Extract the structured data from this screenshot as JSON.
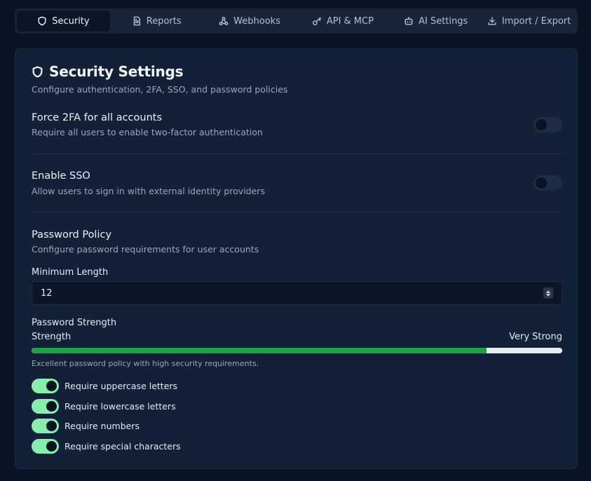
{
  "tabs": [
    {
      "label": "Security",
      "icon": "shield-icon",
      "active": true
    },
    {
      "label": "Reports",
      "icon": "document-icon",
      "active": false
    },
    {
      "label": "Webhooks",
      "icon": "webhook-icon",
      "active": false
    },
    {
      "label": "API & MCP",
      "icon": "key-icon",
      "active": false
    },
    {
      "label": "AI Settings",
      "icon": "bot-icon",
      "active": false
    },
    {
      "label": "Import / Export",
      "icon": "download-icon",
      "active": false
    }
  ],
  "card": {
    "title": "Security Settings",
    "subtitle": "Configure authentication, 2FA, SSO, and password policies"
  },
  "force2fa": {
    "title": "Force 2FA for all accounts",
    "description": "Require all users to enable two-factor authentication",
    "enabled": false
  },
  "sso": {
    "title": "Enable SSO",
    "description": "Allow users to sign in with external identity providers",
    "enabled": false
  },
  "password_policy": {
    "title": "Password Policy",
    "description": "Configure password requirements for user accounts",
    "min_length_label": "Minimum Length",
    "min_length_value": "12",
    "strength_heading": "Password Strength",
    "strength_label": "Strength",
    "strength_value": "Very Strong",
    "strength_fraction": 0.857,
    "hint": "Excellent password policy with high security requirements.",
    "requirements": [
      {
        "label": "Require uppercase letters",
        "enabled": true
      },
      {
        "label": "Require lowercase letters",
        "enabled": true
      },
      {
        "label": "Require numbers",
        "enabled": true
      },
      {
        "label": "Require special characters",
        "enabled": true
      }
    ]
  },
  "colors": {
    "background": "#0b1424",
    "card": "#122038",
    "toggle_on": "#86efac",
    "progress_fill": "#1aa34a"
  }
}
